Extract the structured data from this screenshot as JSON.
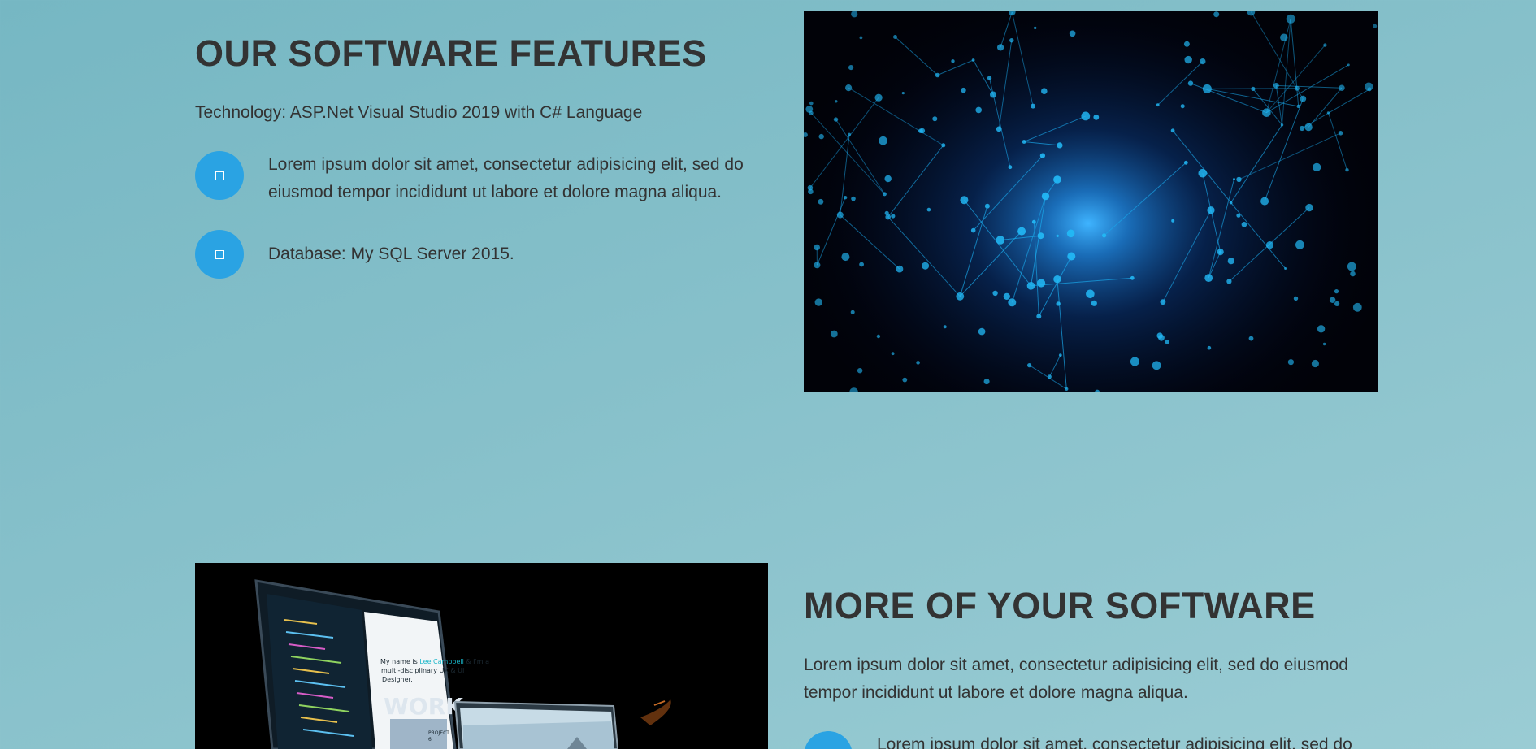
{
  "section1": {
    "title": "OUR SOFTWARE FEATURES",
    "subtitle": "Technology: ASP.Net Visual Studio 2019 with C# Language",
    "features": [
      {
        "icon": "square-outline-icon",
        "text_line1": "Lorem ipsum dolor sit amet, consectetur adipisicing elit, sed do",
        "text_line2": "eiusmod tempor incididunt ut labore et dolore magna aliqua."
      },
      {
        "icon": "square-outline-icon",
        "text": "Database: My SQL Server 2015."
      }
    ],
    "image": "network-nodes-image"
  },
  "section2": {
    "title": "MORE OF YOUR SOFTWARE",
    "description_line1": "Lorem ipsum dolor sit amet, consectetur adipisicing elit, sed do eiusmod",
    "description_line2": "tempor incididunt ut labore et dolore magna aliqua.",
    "features": [
      {
        "icon": "square-outline-icon",
        "text": "Lorem ipsum dolor sit amet, consectetur adipisicing elit, sed do"
      }
    ],
    "image": "laptop-devices-image",
    "laptop_screen": {
      "headline_a": "My name is ",
      "headline_name": "Lee Campbell",
      "headline_b": " & I'm a",
      "headline_line2": "multi-disciplinary UX & UI",
      "headline_line3": "Designer.",
      "watermark": "WORK",
      "project_label": "PROJECT",
      "project_number": "6"
    }
  },
  "colors": {
    "background_start": "#76b7c3",
    "background_end": "#9accd4",
    "heading": "#333333",
    "text": "#333333",
    "accent": "#2aa3e3"
  }
}
